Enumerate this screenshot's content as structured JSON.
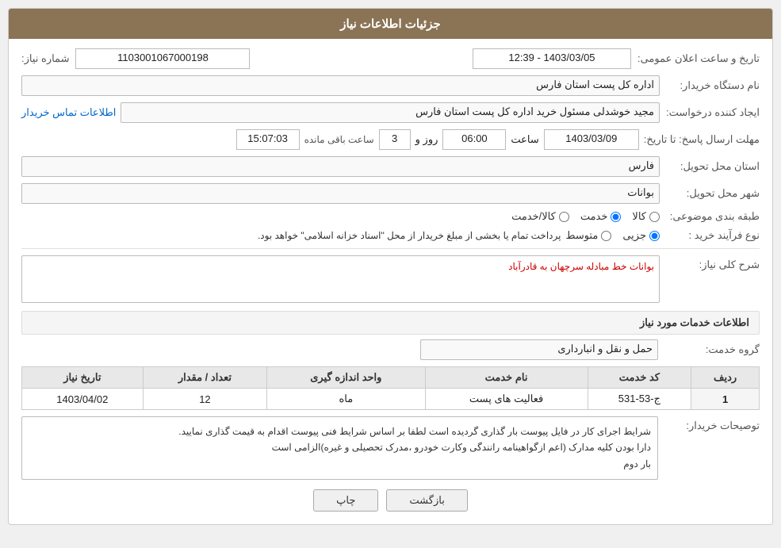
{
  "header": {
    "title": "جزئیات اطلاعات نیاز"
  },
  "fields": {
    "need_number_label": "شماره نیاز:",
    "need_number_value": "1103001067000198",
    "buyer_org_label": "نام دستگاه خریدار:",
    "buyer_org_value": "اداره کل پست استان فارس",
    "announce_datetime_label": "تاریخ و ساعت اعلان عمومی:",
    "announce_datetime_value": "1403/03/05 - 12:39",
    "creator_label": "ایجاد کننده درخواست:",
    "creator_value": "مجید خوشدلی مسئول خرید اداره کل پست استان فارس",
    "contact_link": "اطلاعات تماس خریدار",
    "deadline_label": "مهلت ارسال پاسخ: تا تاریخ:",
    "deadline_date": "1403/03/09",
    "deadline_time_label": "ساعت",
    "deadline_time": "06:00",
    "deadline_days_label": "روز و",
    "deadline_days": "3",
    "remaining_time_label": "ساعت باقی مانده",
    "remaining_time": "15:07:03",
    "province_label": "استان محل تحویل:",
    "province_value": "فارس",
    "city_label": "شهر محل تحویل:",
    "city_value": "بوانات",
    "category_label": "طبقه بندی موضوعی:",
    "category_options": [
      "کالا",
      "خدمت",
      "کالا/خدمت"
    ],
    "category_selected": "خدمت",
    "purchase_type_label": "نوع فرآیند خرید :",
    "purchase_type_options": [
      "جزیی",
      "متوسط"
    ],
    "purchase_type_selected": "جزیی",
    "purchase_note": "پرداخت تمام یا بخشی از مبلغ خریدار از محل \"اسناد خزانه اسلامی\" خواهد بود.",
    "description_label": "شرح کلی نیاز:",
    "description_value": "بوانات خط مبادله سرچهان به قادرآباد",
    "services_section_label": "اطلاعات خدمات مورد نیاز",
    "service_group_label": "گروه خدمت:",
    "service_group_value": "حمل و نقل و انبارداری",
    "table": {
      "columns": [
        "ردیف",
        "کد خدمت",
        "نام خدمت",
        "واحد اندازه گیری",
        "تعداد / مقدار",
        "تاریخ نیاز"
      ],
      "rows": [
        {
          "row_num": "1",
          "service_code": "ج-53-531",
          "service_name": "فعالیت های پست",
          "unit": "ماه",
          "quantity": "12",
          "need_date": "1403/04/02"
        }
      ]
    },
    "buyer_notes_label": "توصیحات خریدار:",
    "buyer_notes_value": "شرایط اجرای کار در فایل پیوست بار گذاری گردیده است لطفا بر اساس شرایط فنی پیوست اقدام به قیمت گذاری نمایید.\nدارا بودن کلیه مدارک (اعم ازگواهینامه رانندگی وکارت خودرو ،مدرک تحصیلی و غیره)الزامی است\nبار دوم",
    "buttons": {
      "print": "چاپ",
      "back": "بازگشت"
    }
  }
}
